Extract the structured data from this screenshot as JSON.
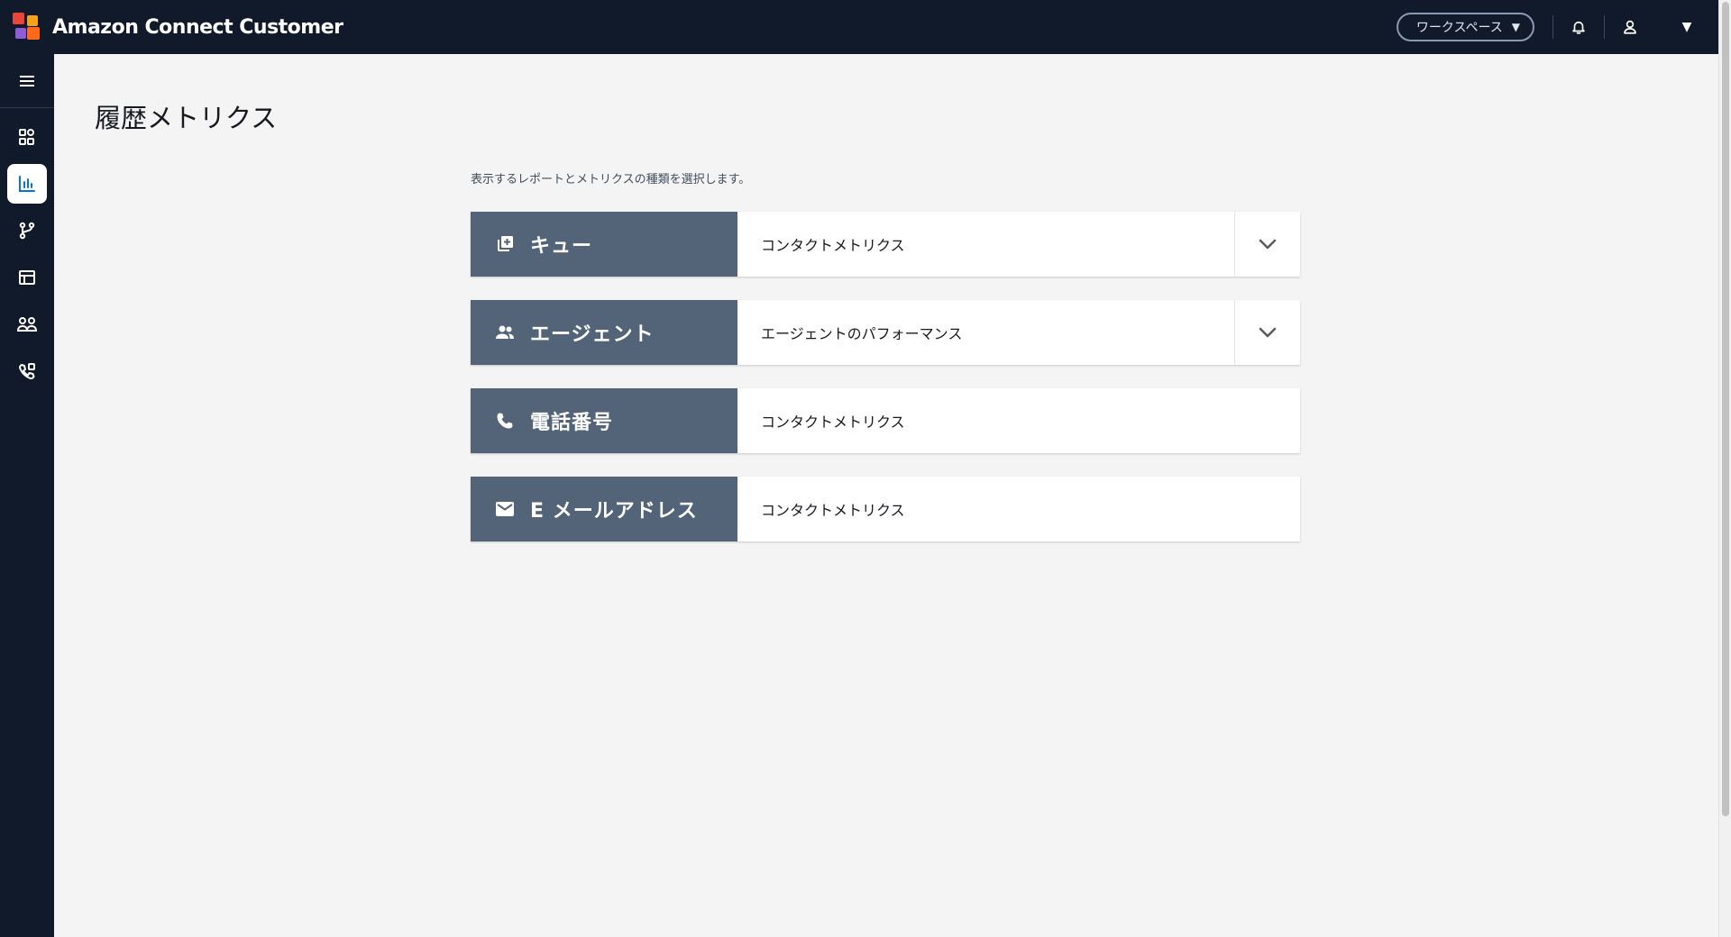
{
  "header": {
    "app_title": "Amazon Connect Customer",
    "workspace_label": "ワークスペース",
    "logo_colors": [
      "#e8453c",
      "#f7a21b",
      "#8e5bd9",
      "#ff6a1a"
    ]
  },
  "sidebar": {
    "items": [
      {
        "icon": "dashboard-icon",
        "active": false
      },
      {
        "icon": "bar-chart-icon",
        "active": true
      },
      {
        "icon": "routing-flow-icon",
        "active": false
      },
      {
        "icon": "table-layout-icon",
        "active": false
      },
      {
        "icon": "users-group-icon",
        "active": false
      },
      {
        "icon": "phone-settings-icon",
        "active": false
      }
    ]
  },
  "main": {
    "page_title": "履歴メトリクス",
    "instructions": "表示するレポートとメトリクスの種類を選択します。",
    "reports": [
      {
        "type_label": "キュー",
        "icon": "queue-add-icon",
        "metric": "コンタクトメトリクス",
        "has_dropdown": true
      },
      {
        "type_label": "エージェント",
        "icon": "agents-icon",
        "metric": "エージェントのパフォーマンス",
        "has_dropdown": true
      },
      {
        "type_label": "電話番号",
        "icon": "phone-icon",
        "metric": "コンタクトメトリクス",
        "has_dropdown": false
      },
      {
        "type_label": "E メールアドレス",
        "icon": "email-icon",
        "metric": "コンタクトメトリクス",
        "has_dropdown": false
      }
    ]
  },
  "colors": {
    "topbar_bg": "#111a2a",
    "report_type_bg": "#536378",
    "active_icon": "#0972d3",
    "page_bg": "#f4f4f4"
  }
}
